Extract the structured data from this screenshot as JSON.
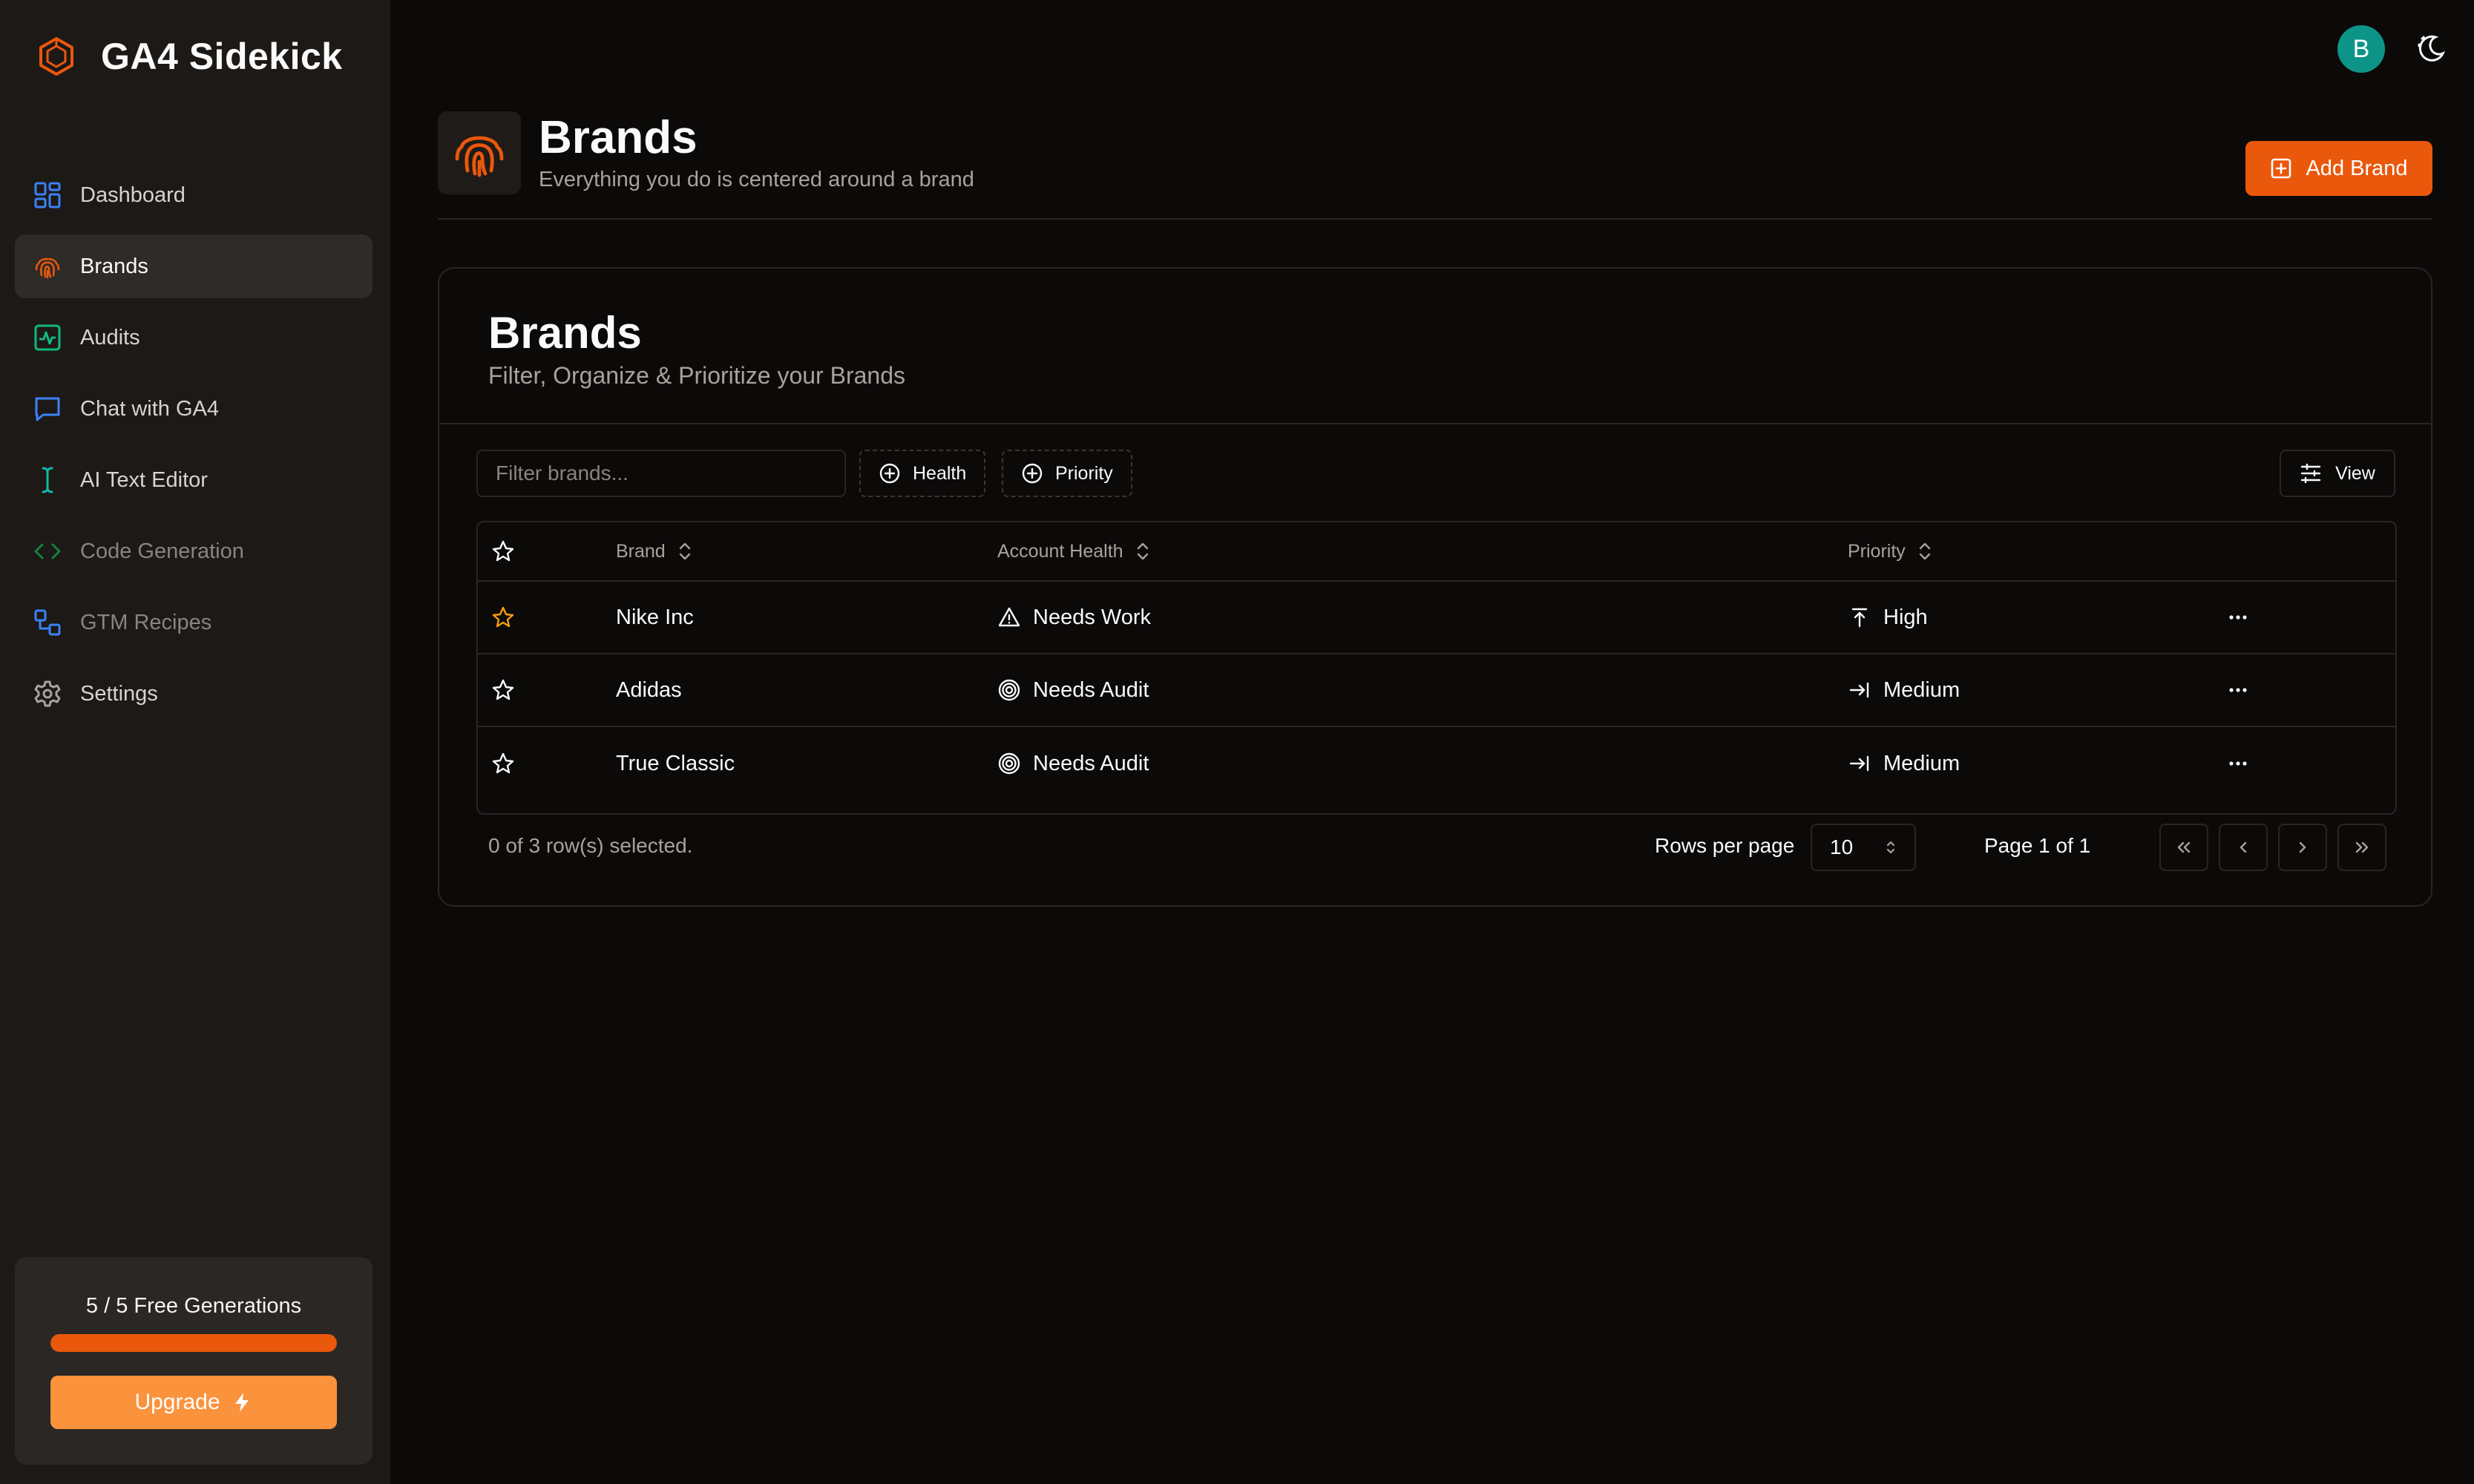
{
  "app": {
    "name": "GA4 Sidekick",
    "brand_color": "#ea580c"
  },
  "sidebar": {
    "items": [
      {
        "label": "Dashboard",
        "icon": "dashboard-icon",
        "active": false
      },
      {
        "label": "Brands",
        "icon": "fingerprint-icon",
        "active": true
      },
      {
        "label": "Audits",
        "icon": "activity-icon",
        "active": false
      },
      {
        "label": "Chat with GA4",
        "icon": "chat-icon",
        "active": false
      },
      {
        "label": "AI Text Editor",
        "icon": "text-cursor-icon",
        "active": false
      },
      {
        "label": "Code Generation",
        "icon": "code-icon",
        "active": false
      },
      {
        "label": "GTM Recipes",
        "icon": "workflow-icon",
        "active": false
      },
      {
        "label": "Settings",
        "icon": "gear-icon",
        "active": false
      }
    ],
    "generations": {
      "label": "5 / 5 Free Generations",
      "used_fraction": 1.0
    },
    "upgrade_label": "Upgrade"
  },
  "topbar": {
    "avatar_initial": "B",
    "avatar_color": "#0d9488"
  },
  "header": {
    "title": "Brands",
    "subtitle": "Everything you do is centered around a brand",
    "add_button_label": "Add Brand"
  },
  "card": {
    "title": "Brands",
    "subtitle": "Filter, Organize & Prioritize your Brands",
    "filter_placeholder": "Filter brands...",
    "health_filter_label": "Health",
    "priority_filter_label": "Priority",
    "view_label": "View"
  },
  "table": {
    "columns": {
      "brand": "Brand",
      "health": "Account Health",
      "priority": "Priority"
    },
    "rows": [
      {
        "starred": true,
        "brand": "Nike Inc",
        "health": "Needs Work",
        "health_icon": "warning-triangle-icon",
        "priority": "High",
        "priority_icon": "arrow-up-to-line-icon"
      },
      {
        "starred": false,
        "brand": "Adidas",
        "health": "Needs Audit",
        "health_icon": "target-icon",
        "priority": "Medium",
        "priority_icon": "arrow-right-to-line-icon"
      },
      {
        "starred": false,
        "brand": "True Classic",
        "health": "Needs Audit",
        "health_icon": "target-icon",
        "priority": "Medium",
        "priority_icon": "arrow-right-to-line-icon"
      }
    ],
    "star_color": "#f59e0b"
  },
  "footer": {
    "selection_text": "0 of 3 row(s) selected.",
    "rows_per_page_label": "Rows per page",
    "rows_per_page_value": "10",
    "page_text": "Page 1 of 1"
  }
}
